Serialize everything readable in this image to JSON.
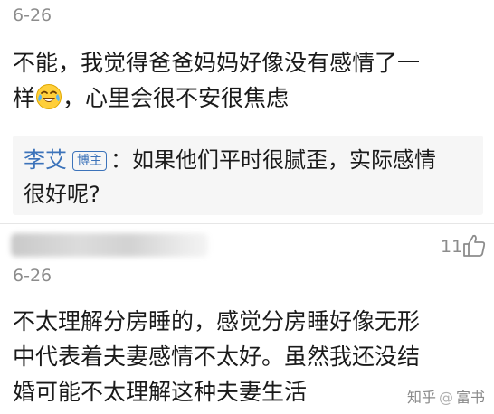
{
  "comment1": {
    "date": "6-26",
    "line1": "不能，我觉得爸爸妈妈好像没有感情了一",
    "line2_before_emoji": "样",
    "line2_after_emoji": "，心里会很不安很焦虑",
    "emoji": "laughing-crying-emoji"
  },
  "reply": {
    "author": "李艾",
    "badge": "博主",
    "line1": "：如果他们平时很腻歪，实际感情",
    "line2": "很好呢?"
  },
  "comment2": {
    "likes": "11",
    "date": "6-26",
    "line1": "不太理解分房睡的，感觉分房睡好像无形",
    "line2": "中代表着夫妻感情不太好。虽然我还没结",
    "line3": "婚可能不太理解这种夫妻生活"
  },
  "watermark": {
    "site": "知乎",
    "separator": "@",
    "user": "富书"
  },
  "colors": {
    "author_blue": "#3c73ba",
    "secondary_gray": "#8c8c8c",
    "reply_bg": "#f6f6f6"
  }
}
